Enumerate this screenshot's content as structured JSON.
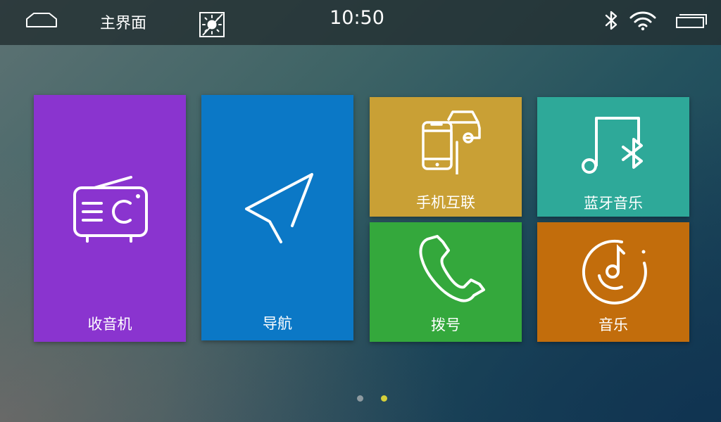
{
  "status_bar": {
    "title": "主界面",
    "time": "10:50",
    "icons": [
      "home-icon",
      "brightness-icon",
      "bluetooth-icon",
      "wifi-icon",
      "recent-apps-icon"
    ]
  },
  "tiles": [
    {
      "id": "radio",
      "label": "收音机",
      "icon": "radio-icon",
      "color": "#8a34cf"
    },
    {
      "id": "navigation",
      "label": "导航",
      "icon": "navigation-arrow-icon",
      "color": "#0b78c6"
    },
    {
      "id": "phone-link",
      "label": "手机互联",
      "icon": "phone-car-link-icon",
      "color": "#c9a035"
    },
    {
      "id": "bluetooth-music",
      "label": "蓝牙音乐",
      "icon": "bluetooth-music-icon",
      "color": "#2ea999"
    },
    {
      "id": "dial",
      "label": "拨号",
      "icon": "phone-handset-icon",
      "color": "#34a83c"
    },
    {
      "id": "music",
      "label": "音乐",
      "icon": "music-disc-icon",
      "color": "#c26d0c"
    }
  ],
  "pagination": {
    "pages": 2,
    "current": 2,
    "active_color": "#d6d03a"
  }
}
